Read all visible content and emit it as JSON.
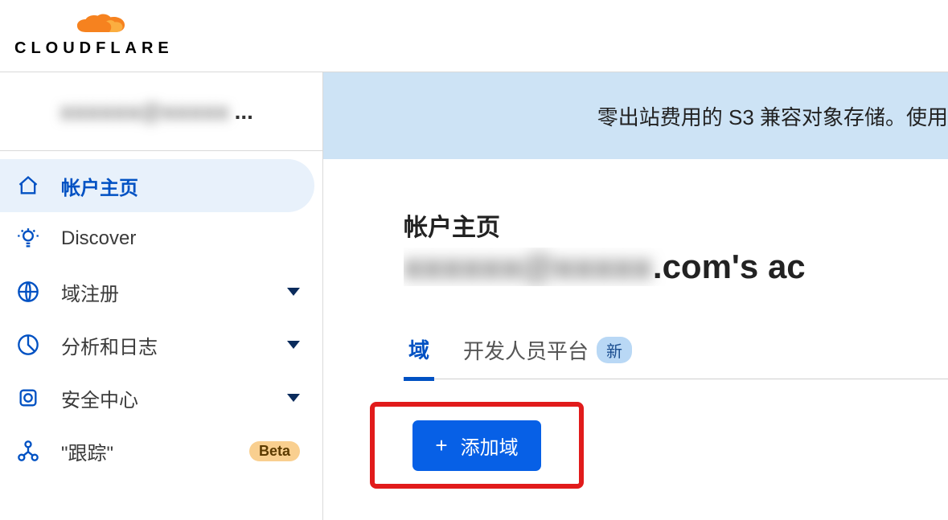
{
  "brand": {
    "name": "CLOUDFLARE"
  },
  "account": {
    "label_blurred": "xxxxxx@xxxxx",
    "ellipsis": "..."
  },
  "sidebar": {
    "items": [
      {
        "label": "帐户主页",
        "icon": "home-icon",
        "active": true,
        "expandable": false
      },
      {
        "label": "Discover",
        "icon": "lightbulb-icon",
        "active": false,
        "expandable": false
      },
      {
        "label": "域注册",
        "icon": "globe-icon",
        "active": false,
        "expandable": true
      },
      {
        "label": "分析和日志",
        "icon": "piechart-icon",
        "active": false,
        "expandable": true
      },
      {
        "label": "安全中心",
        "icon": "shield-icon",
        "active": false,
        "expandable": true
      },
      {
        "label": "\"跟踪\"",
        "icon": "network-icon",
        "active": false,
        "expandable": false,
        "badge": "Beta"
      }
    ]
  },
  "banner": {
    "text": "零出站费用的 S3 兼容对象存储。使用"
  },
  "main": {
    "page_title": "帐户主页",
    "account_email_blurred": "xxxxxx@xxxxx",
    "account_suffix": ".com's ac",
    "tabs": [
      {
        "label": "域",
        "active": true
      },
      {
        "label": "开发人员平台",
        "active": false,
        "badge": "新"
      }
    ],
    "add_domain_label": "添加域"
  }
}
